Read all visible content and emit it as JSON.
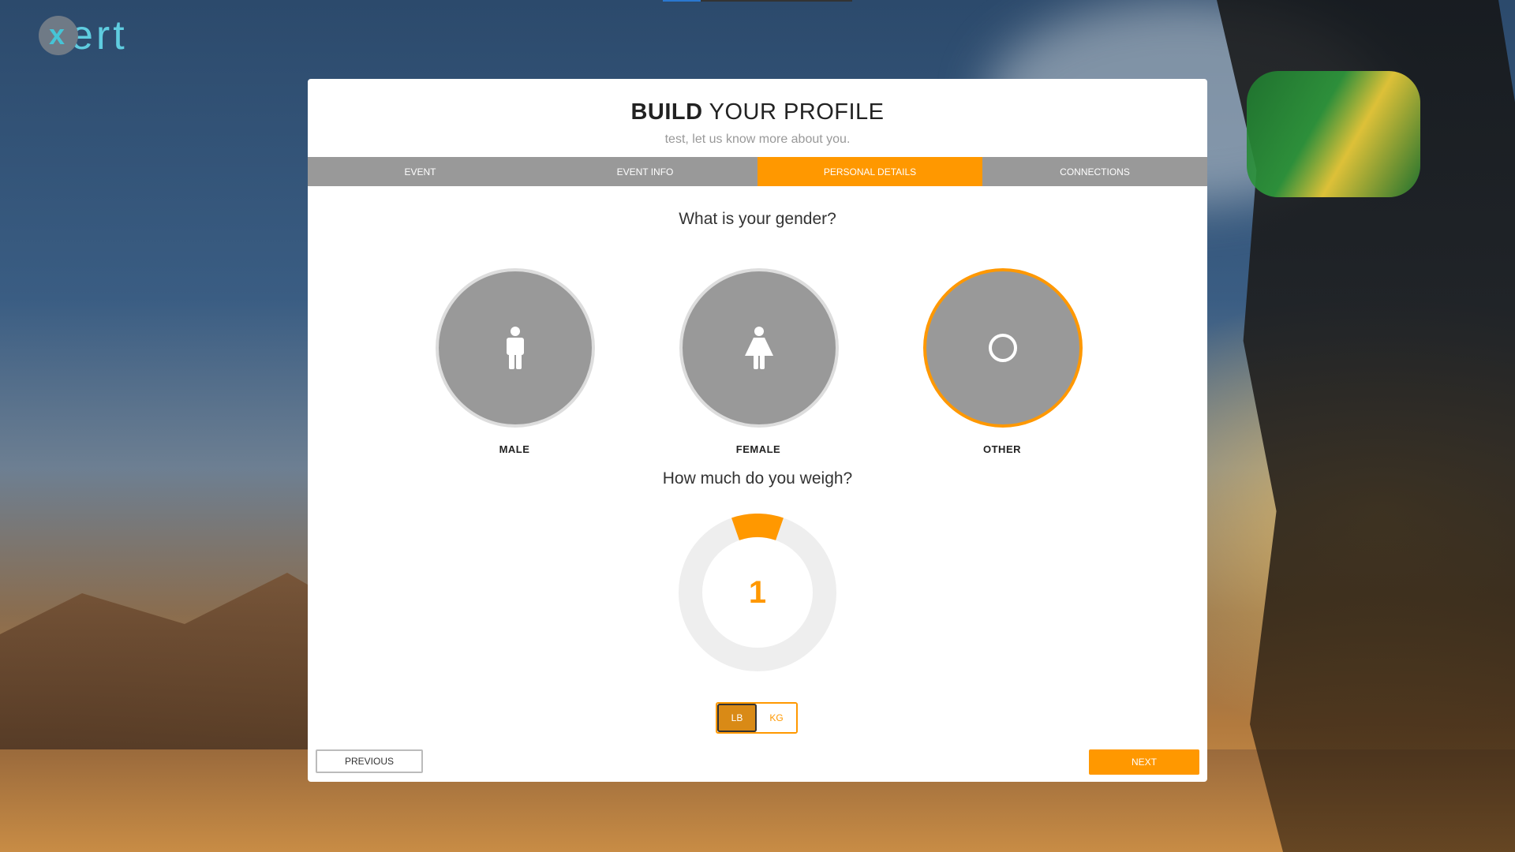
{
  "logo": {
    "mark": "x",
    "text": "ert"
  },
  "card": {
    "title_bold": "BUILD",
    "title_rest": " YOUR PROFILE",
    "subtitle": "test, let us know more about you."
  },
  "tabs": [
    {
      "label": "EVENT",
      "active": false
    },
    {
      "label": "EVENT INFO",
      "active": false
    },
    {
      "label": "PERSONAL DETAILS",
      "active": true
    },
    {
      "label": "CONNECTIONS",
      "active": false
    }
  ],
  "gender": {
    "question": "What is your gender?",
    "options": [
      {
        "label": "MALE",
        "icon": "male-icon",
        "selected": false
      },
      {
        "label": "FEMALE",
        "icon": "female-icon",
        "selected": false
      },
      {
        "label": "OTHER",
        "icon": "circle-icon",
        "selected": true
      }
    ]
  },
  "weight": {
    "question": "How much do you weigh?",
    "value": "1",
    "units": [
      {
        "label": "LB",
        "active": true
      },
      {
        "label": "KG",
        "active": false
      }
    ]
  },
  "nav": {
    "previous": "PREVIOUS",
    "next": "NEXT"
  },
  "colors": {
    "accent": "#ff9800",
    "tab_bg": "#999999",
    "logo": "#5fcde0"
  }
}
